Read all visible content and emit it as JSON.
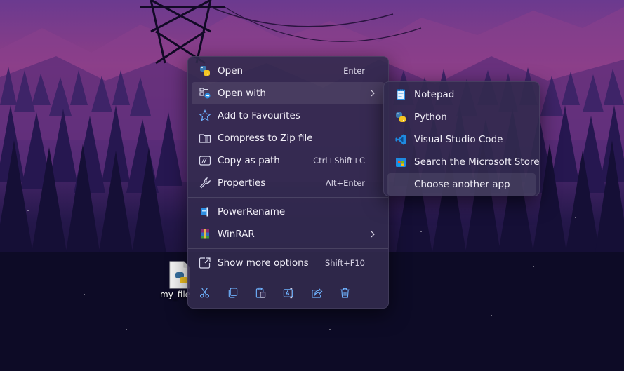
{
  "desktop": {
    "file_label": "my_file"
  },
  "context_menu": {
    "items": [
      {
        "label": "Open",
        "shortcut": "Enter",
        "icon": "python-icon"
      },
      {
        "label": "Open with",
        "shortcut": "",
        "icon": "open-with-icon"
      },
      {
        "label": "Add to Favourites",
        "shortcut": "",
        "icon": "star-icon"
      },
      {
        "label": "Compress to Zip file",
        "shortcut": "",
        "icon": "zip-folder-icon"
      },
      {
        "label": "Copy as path",
        "shortcut": "Ctrl+Shift+C",
        "icon": "copy-path-icon"
      },
      {
        "label": "Properties",
        "shortcut": "Alt+Enter",
        "icon": "wrench-icon"
      },
      {
        "label": "PowerRename",
        "shortcut": "",
        "icon": "powerrename-icon"
      },
      {
        "label": "WinRAR",
        "shortcut": "",
        "icon": "winrar-icon"
      },
      {
        "label": "Show more options",
        "shortcut": "Shift+F10",
        "icon": "show-more-icon"
      }
    ],
    "toolbar": [
      "cut-icon",
      "copy-icon",
      "paste-icon",
      "rename-icon",
      "share-icon",
      "delete-icon"
    ]
  },
  "submenu": {
    "items": [
      {
        "label": "Notepad",
        "icon": "notepad-icon"
      },
      {
        "label": "Python",
        "icon": "python-icon"
      },
      {
        "label": "Visual Studio Code",
        "icon": "vscode-icon"
      },
      {
        "label": "Search the Microsoft Store",
        "icon": "store-icon"
      },
      {
        "label": "Choose another app",
        "icon": ""
      }
    ]
  },
  "colors": {
    "menu_bg": "#322a4e",
    "hover_bg": "#3e3760",
    "accent_blue": "#2d8fe3",
    "text": "#f2f0f8"
  }
}
